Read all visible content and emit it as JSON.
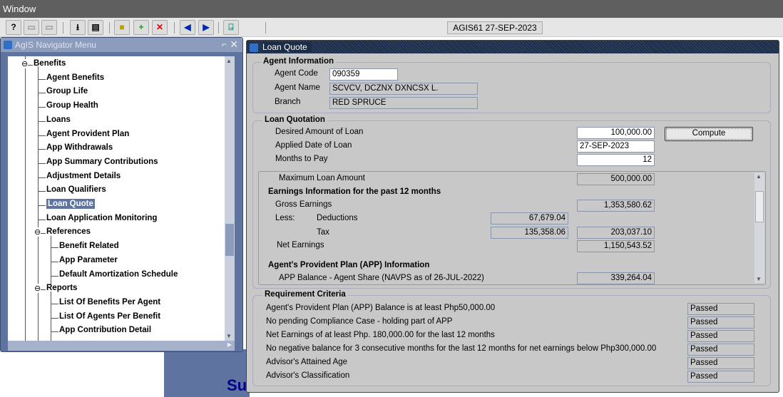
{
  "menubar": {
    "window": "Window"
  },
  "toolbar": {
    "status": "AGIS61  27-SEP-2023"
  },
  "background": {
    "text": "Su"
  },
  "navigator": {
    "title": "AgIS Navigator Menu",
    "items": [
      {
        "label": "Benefits",
        "level": 0
      },
      {
        "label": "Agent Benefits",
        "level": 1
      },
      {
        "label": "Group Life",
        "level": 1
      },
      {
        "label": "Group Health",
        "level": 1
      },
      {
        "label": "Loans",
        "level": 1
      },
      {
        "label": "Agent Provident Plan",
        "level": 1
      },
      {
        "label": "App Withdrawals",
        "level": 1
      },
      {
        "label": "App Summary Contributions",
        "level": 1
      },
      {
        "label": "Adjustment Details",
        "level": 1
      },
      {
        "label": "Loan Qualifiers",
        "level": 1
      },
      {
        "label": "Loan Quote",
        "level": 1,
        "selected": true
      },
      {
        "label": "Loan Application Monitoring",
        "level": 1
      },
      {
        "label": "References",
        "level": 0.5
      },
      {
        "label": "Benefit Related",
        "level": 2
      },
      {
        "label": "App Parameter",
        "level": 2
      },
      {
        "label": "Default Amortization Schedule",
        "level": 2
      },
      {
        "label": "Reports",
        "level": 0.5
      },
      {
        "label": "List Of Benefits Per Agent",
        "level": 2
      },
      {
        "label": "List Of Agents Per Benefit",
        "level": 2
      },
      {
        "label": "App Contribution Detail",
        "level": 2
      }
    ]
  },
  "loan_quote": {
    "title": "Loan Quote",
    "agent_info": {
      "heading": "Agent Information",
      "code_label": "Agent Code",
      "code": "090359",
      "name_label": "Agent Name",
      "name": "SCVCV, DCZNX DXNCSX L.",
      "branch_label": "Branch",
      "branch": "RED SPRUCE"
    },
    "quotation": {
      "heading": "Loan Quotation",
      "desired_label": "Desired Amount of Loan",
      "desired": "100,000.00",
      "compute": "Compute",
      "date_label": "Applied Date of Loan",
      "date": "27-SEP-2023",
      "months_label": "Months to Pay",
      "months": "12",
      "max_label": "Maximum Loan Amount",
      "max": "500,000.00",
      "earnings_heading": "Earnings Information for the past 12 months",
      "gross_label": "Gross Earnings",
      "gross": "1,353,580.62",
      "less_label": "Less:",
      "deductions_label": "Deductions",
      "deductions": "67,679.04",
      "tax_label": "Tax",
      "tax": "135,358.06",
      "total_less": "203,037.10",
      "net_label": "Net Earnings",
      "net": "1,150,543.52",
      "app_heading": "Agent's Provident Plan (APP) Information",
      "app_label": "APP Balance - Agent Share (NAVPS as of 26-JUL-2022)",
      "app": "339,264.04"
    },
    "requirements": {
      "heading": "Requirement Criteria",
      "items": [
        {
          "label": "Agent's Provident Plan (APP) Balance is at least Php50,000.00",
          "status": "Passed"
        },
        {
          "label": "No pending Compliance Case - holding part of APP",
          "status": "Passed"
        },
        {
          "label": "Net Earnings of at least Php. 180,000.00 for the last 12 months",
          "status": "Passed"
        },
        {
          "label": "No negative balance for 3 consecutive months for the last 12 months for net earnings below Php300,000.00",
          "status": "Passed"
        },
        {
          "label": "Advisor's Attained Age",
          "status": "Passed"
        },
        {
          "label": "Advisor's Classification",
          "status": "Passed"
        }
      ]
    }
  }
}
